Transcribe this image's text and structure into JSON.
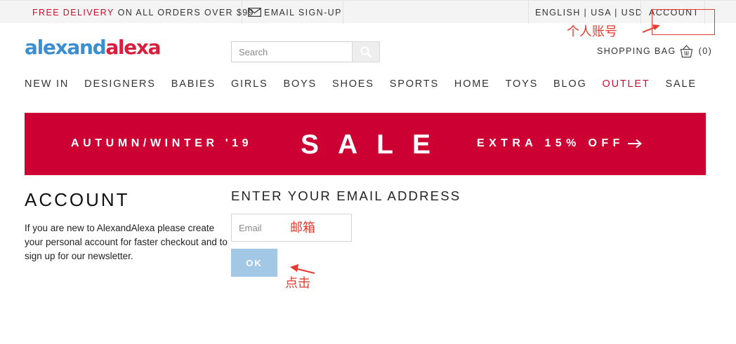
{
  "topbar": {
    "free_delivery_red": "FREE DELIVERY",
    "free_delivery_rest": "ON ALL ORDERS OVER $99",
    "email_signup": "EMAIL SIGN-UP",
    "locale": "ENGLISH | USA | USD",
    "account": "ACCOUNT"
  },
  "logo": {
    "part1": "alex",
    "part2": "and",
    "part3": "alexa"
  },
  "search": {
    "placeholder": "Search",
    "icon": "search-icon"
  },
  "bag": {
    "label": "SHOPPING BAG",
    "count": "(0)",
    "icon": "shopping-basket-icon"
  },
  "nav": {
    "items": [
      "NEW IN",
      "DESIGNERS",
      "BABIES",
      "GIRLS",
      "BOYS",
      "SHOES",
      "SPORTS",
      "HOME",
      "TOYS",
      "BLOG",
      "OUTLET",
      "SALE"
    ]
  },
  "banner": {
    "left": "AUTUMN/WINTER '19",
    "center": "SALE",
    "right": "EXTRA 15% OFF",
    "arrow_icon": "arrow-right-icon",
    "color": "#cc0033"
  },
  "account": {
    "title": "ACCOUNT",
    "description": "If you are new to AlexandAlexa please create your personal account for faster checkout and to sign up for our newsletter.",
    "email_heading": "ENTER YOUR EMAIL ADDRESS",
    "email_placeholder": "Email",
    "ok_label": "OK"
  },
  "annotations": {
    "personal_account": "个人账号",
    "email": "邮箱",
    "click": "点击",
    "color": "#e53a2e"
  },
  "colors": {
    "brand_blue": "#3b8fd0",
    "brand_red": "#d8203e",
    "ok_button": "#a3c8e6"
  }
}
